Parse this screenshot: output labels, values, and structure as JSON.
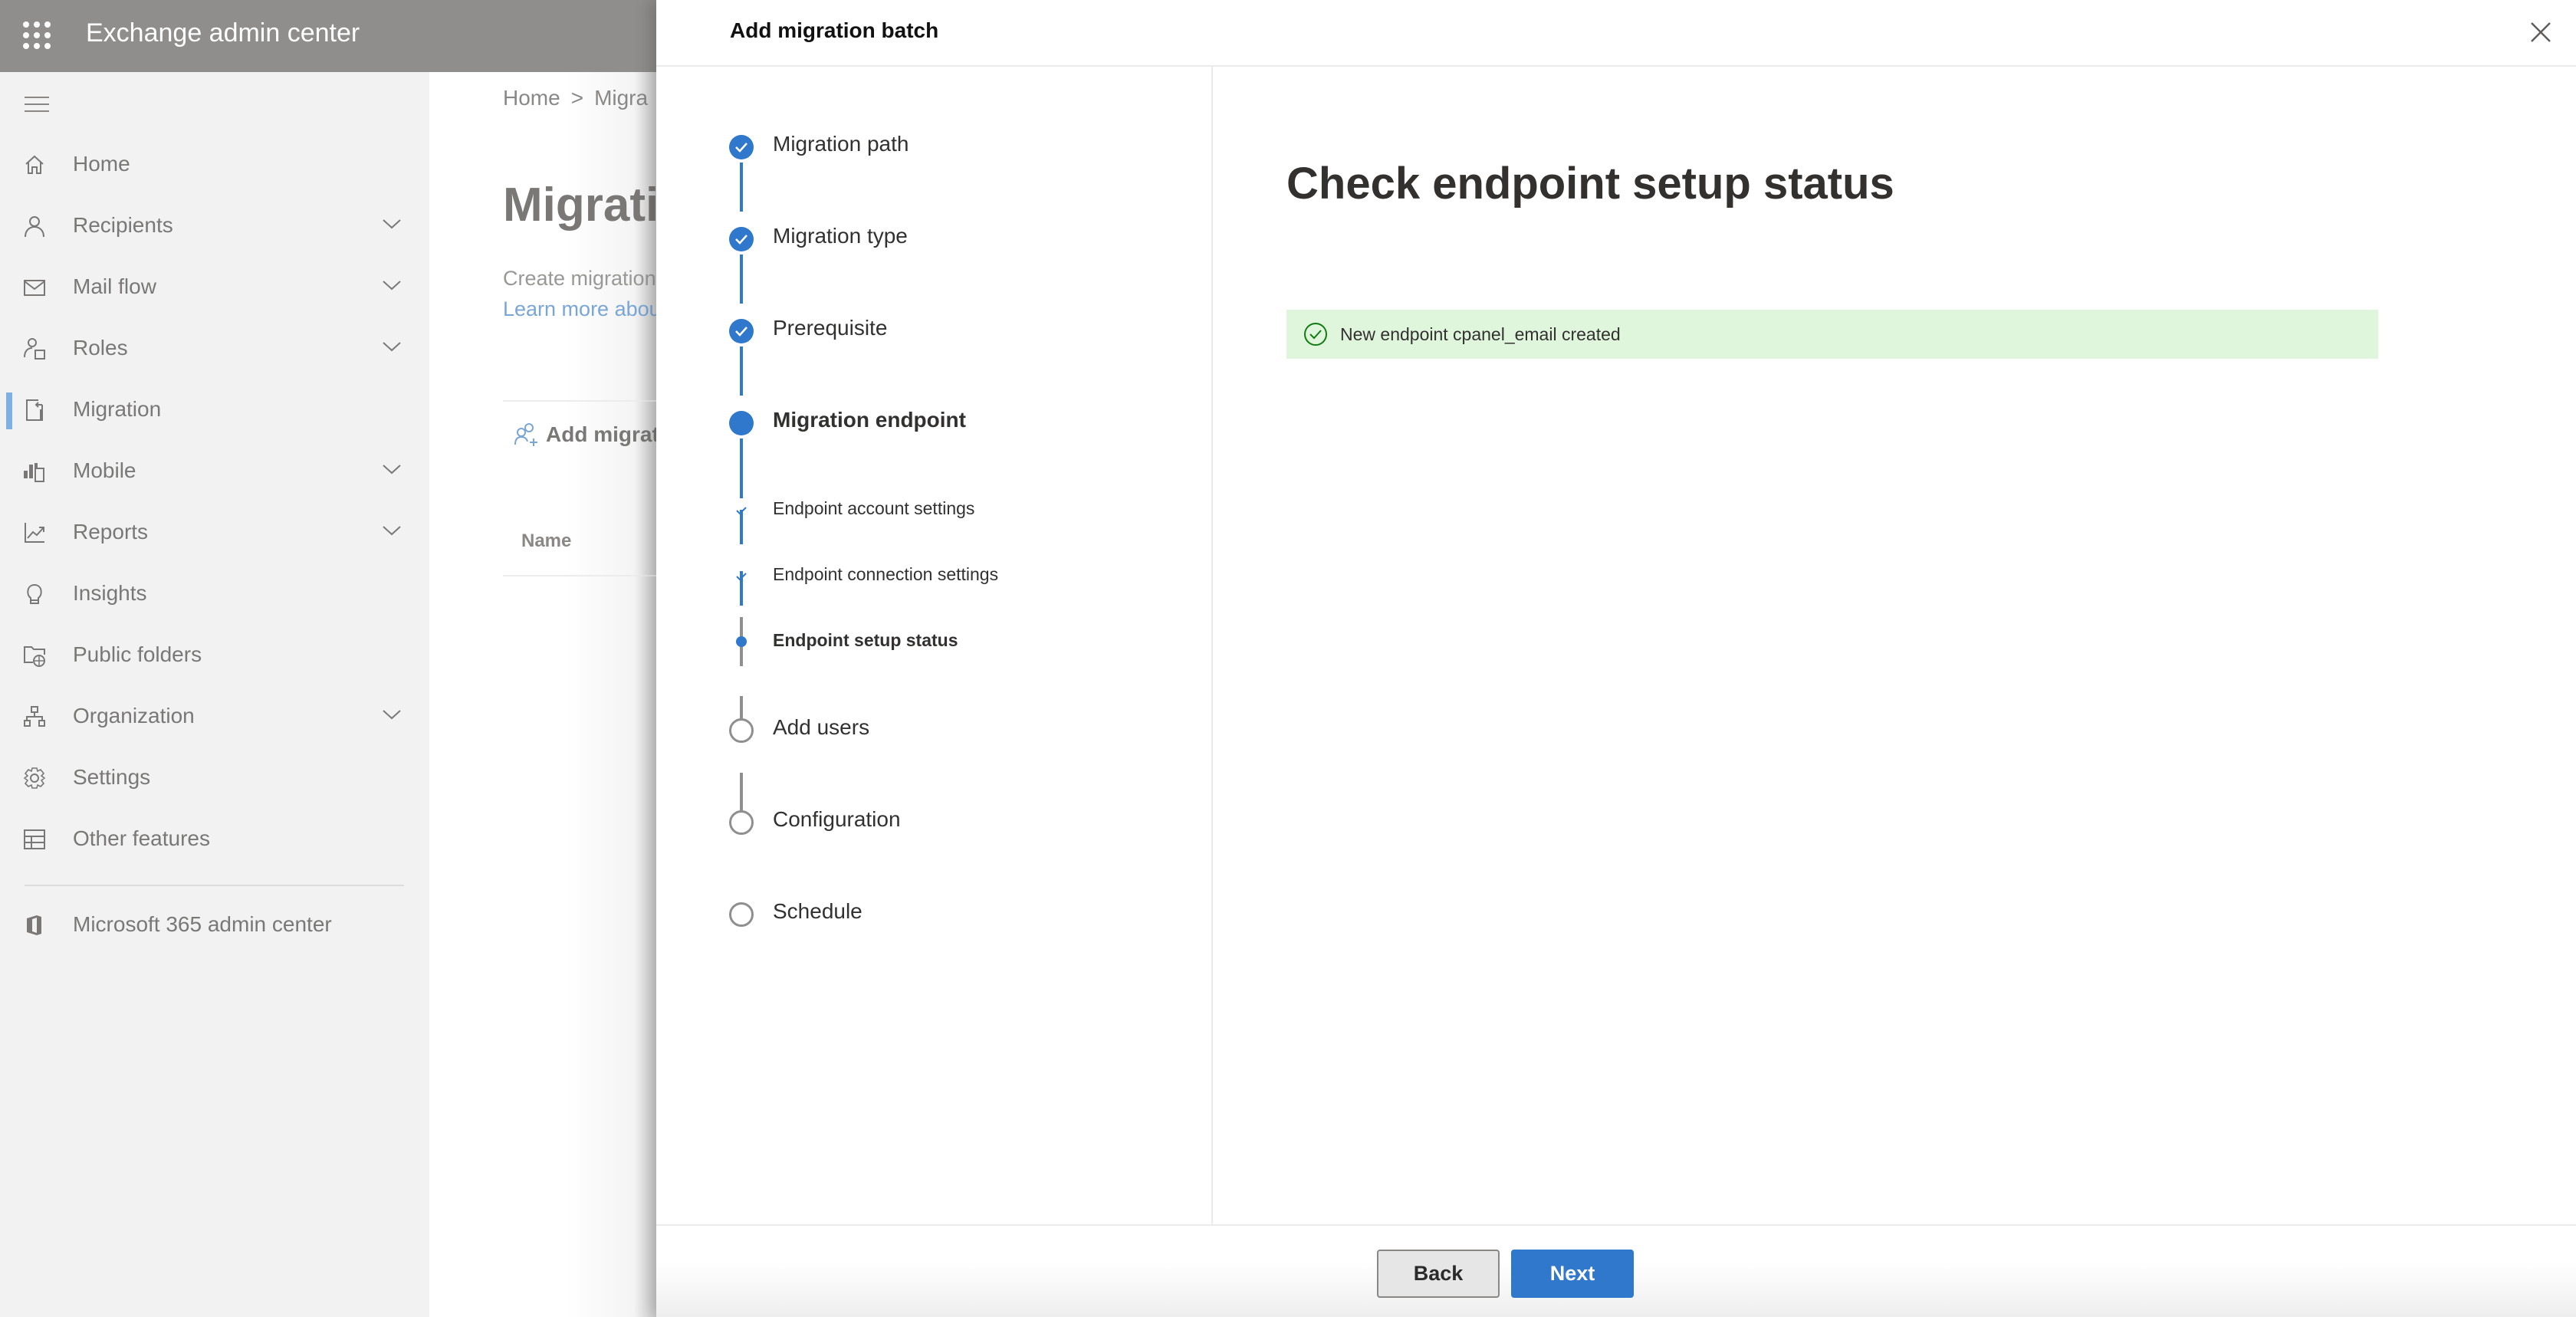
{
  "app": {
    "title": "Exchange admin center",
    "waffle_icon": "waffle-grid-icon"
  },
  "sidebar": {
    "menu_icon": "hamburger-icon",
    "items": [
      {
        "label": "Home",
        "icon": "home-icon",
        "expandable": false,
        "active": false
      },
      {
        "label": "Recipients",
        "icon": "person-icon",
        "expandable": true,
        "active": false
      },
      {
        "label": "Mail flow",
        "icon": "mail-icon",
        "expandable": true,
        "active": false
      },
      {
        "label": "Roles",
        "icon": "person-badge-icon",
        "expandable": true,
        "active": false
      },
      {
        "label": "Migration",
        "icon": "migration-icon",
        "expandable": false,
        "active": true
      },
      {
        "label": "Mobile",
        "icon": "mobile-chart-icon",
        "expandable": true,
        "active": false
      },
      {
        "label": "Reports",
        "icon": "line-chart-icon",
        "expandable": true,
        "active": false
      },
      {
        "label": "Insights",
        "icon": "lightbulb-icon",
        "expandable": false,
        "active": false
      },
      {
        "label": "Public folders",
        "icon": "folder-globe-icon",
        "expandable": false,
        "active": false
      },
      {
        "label": "Organization",
        "icon": "org-chart-icon",
        "expandable": true,
        "active": false
      },
      {
        "label": "Settings",
        "icon": "gear-icon",
        "expandable": false,
        "active": false
      },
      {
        "label": "Other features",
        "icon": "table-icon",
        "expandable": false,
        "active": false
      }
    ],
    "footer_item": {
      "label": "Microsoft 365 admin center",
      "icon": "office-icon"
    }
  },
  "page": {
    "breadcrumb": [
      "Home",
      "Migra"
    ],
    "breadcrumb_separator": ">",
    "title": "Migratio",
    "description": "Create migration",
    "learn_more": "Learn more abou",
    "add_button": "Add migrat",
    "column_name": "Name"
  },
  "panel": {
    "title": "Add migration batch",
    "close_icon": "close-icon",
    "steps": [
      {
        "label": "Migration path",
        "state": "done",
        "level": "main"
      },
      {
        "label": "Migration type",
        "state": "done",
        "level": "main"
      },
      {
        "label": "Prerequisite",
        "state": "done",
        "level": "main"
      },
      {
        "label": "Migration endpoint",
        "state": "current",
        "level": "main"
      },
      {
        "label": "Endpoint account settings",
        "state": "done",
        "level": "sub"
      },
      {
        "label": "Endpoint connection settings",
        "state": "done",
        "level": "sub"
      },
      {
        "label": "Endpoint setup status",
        "state": "current",
        "level": "sub"
      },
      {
        "label": "Add users",
        "state": "todo",
        "level": "main"
      },
      {
        "label": "Configuration",
        "state": "todo",
        "level": "main"
      },
      {
        "label": "Schedule",
        "state": "todo",
        "level": "main"
      }
    ],
    "content": {
      "heading": "Check endpoint setup status",
      "banner": {
        "type": "success",
        "icon": "success-check-circle-icon",
        "message": "New endpoint cpanel_email created"
      }
    },
    "footer": {
      "back_label": "Back",
      "next_label": "Next"
    }
  },
  "colors": {
    "accent": "#2f78cc",
    "success_bg": "#dff6dd",
    "success_icon": "#107c10",
    "todo_gray": "#8f8f8f"
  }
}
